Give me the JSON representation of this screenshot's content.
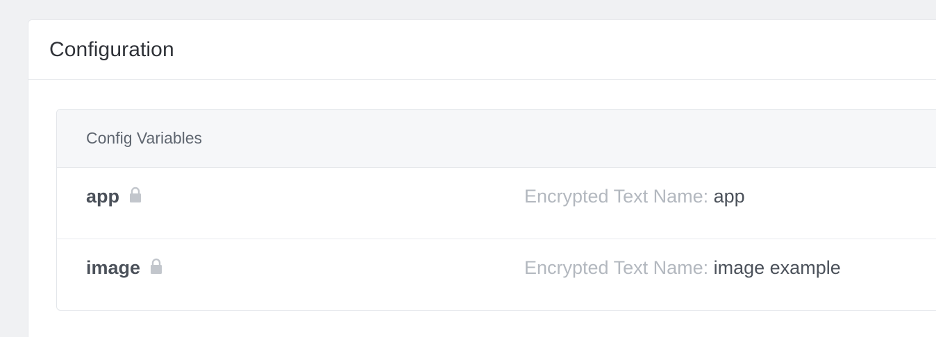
{
  "card": {
    "title": "Configuration"
  },
  "config_variables": {
    "header": "Config Variables",
    "rows": [
      {
        "key": "app",
        "icon": "lock-icon",
        "value_label": "Encrypted Text Name: ",
        "value": "app"
      },
      {
        "key": "image",
        "icon": "lock-icon",
        "value_label": "Encrypted Text Name: ",
        "value": "image example"
      }
    ]
  },
  "colors": {
    "page_background": "#f0f1f3",
    "card_background": "#ffffff",
    "panel_header_background": "#f6f7f9",
    "muted_text": "#b3b8bf",
    "strong_text": "#4b515a"
  }
}
